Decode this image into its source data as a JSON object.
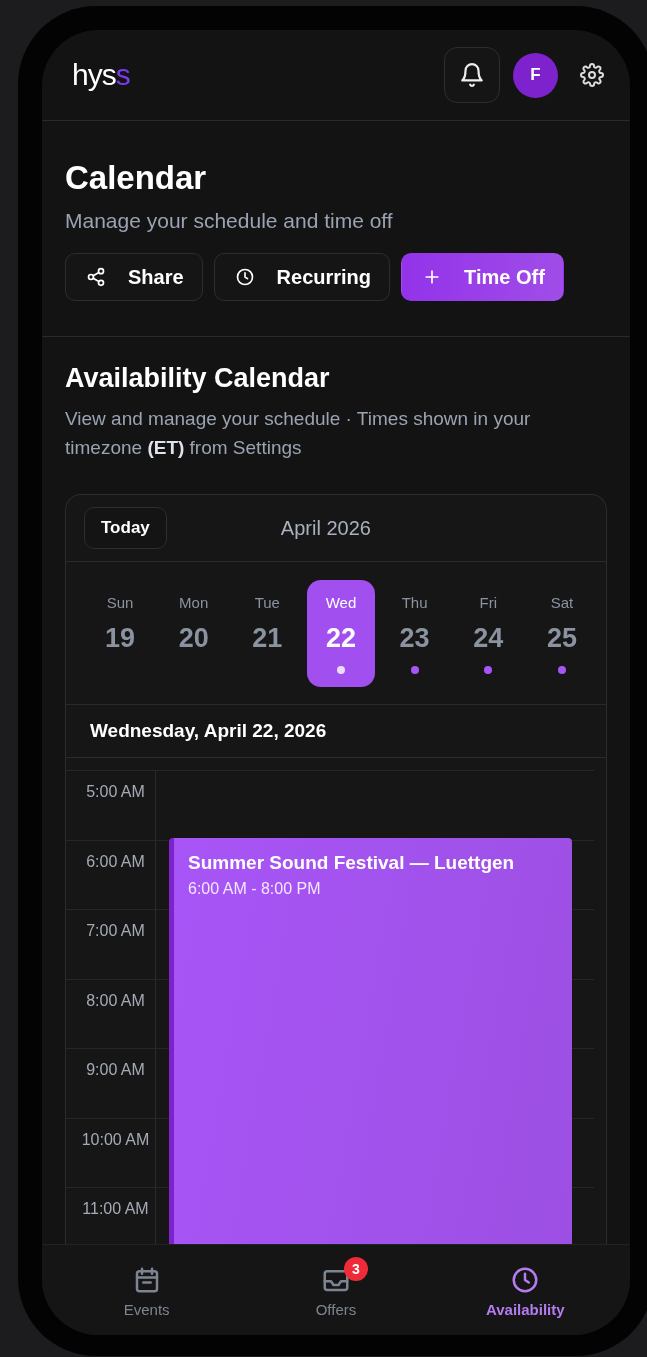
{
  "header": {
    "logo_main": "hys",
    "logo_accent": "s",
    "avatar_initial": "F"
  },
  "page": {
    "title": "Calendar",
    "subtitle": "Manage your schedule and time off"
  },
  "actions": [
    {
      "kind": "share",
      "label": "Share",
      "primary": false
    },
    {
      "kind": "recurring",
      "label": "Recurring",
      "primary": false
    },
    {
      "kind": "add",
      "label": "Time Off",
      "primary": true
    }
  ],
  "availability": {
    "title": "Availability Calendar",
    "description": "View and manage your schedule · Times shown in your timezone **(ET)** from Settings"
  },
  "calendar": {
    "today_button": "Today",
    "month": "April 2026",
    "days": [
      {
        "weekday": "Sun",
        "date": "19",
        "selected": false,
        "has_event": false
      },
      {
        "weekday": "Mon",
        "date": "20",
        "selected": false,
        "has_event": false
      },
      {
        "weekday": "Tue",
        "date": "21",
        "selected": false,
        "has_event": false
      },
      {
        "weekday": "Wed",
        "date": "22",
        "selected": true,
        "has_event": true
      },
      {
        "weekday": "Thu",
        "date": "23",
        "selected": false,
        "has_event": true
      },
      {
        "weekday": "Fri",
        "date": "24",
        "selected": false,
        "has_event": true
      },
      {
        "weekday": "Sat",
        "date": "25",
        "selected": false,
        "has_event": true
      }
    ],
    "selected_date": "Wednesday, April 22, 2026",
    "hours": [
      "5:00 AM",
      "6:00 AM",
      "7:00 AM",
      "8:00 AM",
      "9:00 AM",
      "10:00 AM",
      "11:00 AM"
    ],
    "event": {
      "title": "Summer Sound Festival — Luettgen",
      "time": "6:00 AM - 8:00 PM"
    }
  },
  "nav": [
    {
      "kind": "events",
      "label": "Events",
      "selected": false
    },
    {
      "kind": "offers",
      "label": "Offers",
      "selected": false,
      "badge": "3"
    },
    {
      "kind": "availability",
      "label": "Availability",
      "selected": true
    }
  ]
}
